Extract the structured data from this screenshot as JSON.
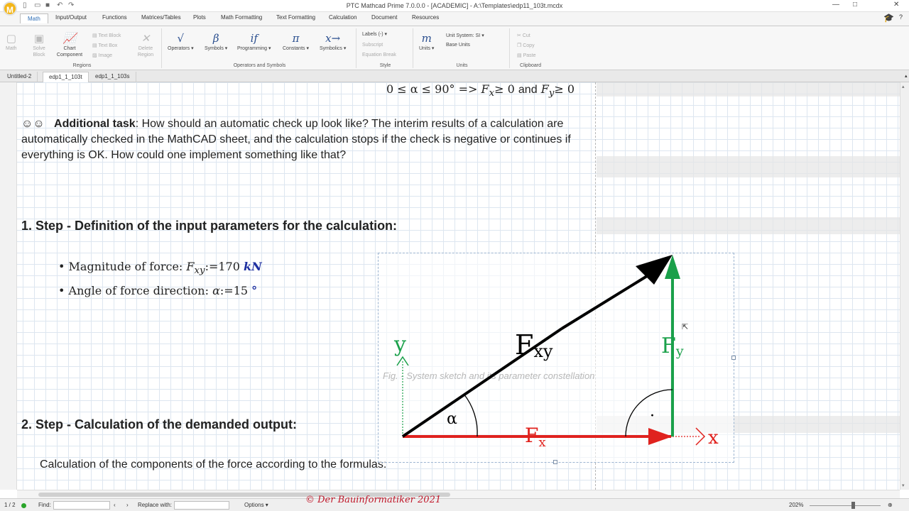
{
  "titlebar": {
    "logo": "M",
    "title": "PTC Mathcad Prime 7.0.0.0 - [ACADEMIC] - A:\\Templates\\edp11_103t.mcdx",
    "quick_access": [
      "new-icon",
      "open-icon",
      "save-icon",
      "undo-icon",
      "redo-icon"
    ],
    "window_controls": [
      "minimize-icon",
      "restore-icon",
      "close-icon"
    ]
  },
  "ribbon_tabs": [
    "Math",
    "Input/Output",
    "Functions",
    "Matrices/Tables",
    "Plots",
    "Math Formatting",
    "Text Formatting",
    "Calculation",
    "Document",
    "Resources"
  ],
  "ribbon": {
    "regions": {
      "label": "Regions",
      "math": "Math",
      "solve_block": "Solve\nBlock",
      "chart": "Chart",
      "component": "Component",
      "text_block": "Text Block",
      "text_box": "Text Box",
      "image": "Image",
      "delete_region": "Delete\nRegion"
    },
    "operators": {
      "label": "Operators and Symbols",
      "operators": "Operators",
      "symbols": "Symbols",
      "programming": "Programming",
      "constants": "Constants",
      "symbolics": "Symbolics",
      "ic_operators": "√",
      "ic_symbols": "β",
      "ic_programming": "if",
      "ic_constants": "π",
      "ic_symbolics": "x→"
    },
    "style": {
      "label": "Style",
      "labels": "Labels",
      "labels_value": "(-)",
      "subscript": "Subscript",
      "equation_break": "Equation Break"
    },
    "units": {
      "label": "Units",
      "units": "Units",
      "ic_units": "m",
      "unit_system": "Unit System:",
      "unit_system_value": "SI",
      "base_units": "Base Units"
    },
    "clipboard": {
      "label": "Clipboard",
      "cut": "Cut",
      "copy": "Copy",
      "paste": "Paste"
    }
  },
  "doc_tabs": [
    "Untitled-2",
    "edp1_1_103t",
    "edp1_1_103s"
  ],
  "worksheet": {
    "top_eq": {
      "lhs": "0 ≤ α ≤ 90°",
      "arrow": "=>",
      "fx": "F",
      "fx_sub": "x",
      "ge0": "≥ 0",
      "and": "and",
      "fy": "F",
      "fy_sub": "y",
      "ge0b": "≥ 0"
    },
    "task": {
      "emoji": "☺☺",
      "bold": "Additional task",
      "text": ": How should an automatic check up look like? The interim results of a calculation are automatically checked in the MathCAD sheet, and the calculation stops if the check is negative or continues if everything is OK. How could one implement something like that?"
    },
    "step1": "1. Step - Definition of the input parameters for the calculation:",
    "bullets": [
      {
        "label": "Magnitude of force:",
        "var": "F",
        "sub": "xy",
        "assign": ":=",
        "value": "170",
        "unit": "kN"
      },
      {
        "label": "Angle of force direction:",
        "var": "α",
        "assign": ":=",
        "value": "15",
        "unit": "°"
      }
    ],
    "step2": "2. Step - Calculation of the demanded output:",
    "calc_text": "Calculation of the components of the force according to the formulas:"
  },
  "figure": {
    "caption": "Fig. - System sketch and its parameter constellation",
    "labels": {
      "y_axis": "y",
      "x_axis": "x",
      "fxy": "F",
      "fxy_sub": "xy",
      "fy": "F",
      "fy_sub": "y",
      "fx": "F",
      "fx_sub": "x",
      "alpha": "α",
      "right_angle_dot": "·"
    },
    "colors": {
      "y_axis": "#1aa04a",
      "x_axis": "#e0221e",
      "fxy": "#000000",
      "fy": "#1aa04a",
      "fx": "#e0221e"
    }
  },
  "watermark": "© Der Bauinformatiker 2021",
  "status": {
    "page": "1 / 2",
    "find": "Find:",
    "replace": "Replace with:",
    "options": "Options",
    "zoom": "202%"
  }
}
